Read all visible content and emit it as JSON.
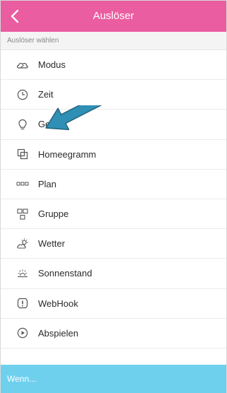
{
  "header": {
    "title": "Auslöser",
    "back_icon": "chevron-left-icon",
    "background_color": "#ea5da0"
  },
  "section": {
    "label": "Auslöser wählen"
  },
  "items": [
    {
      "label": "Modus",
      "icon": "cloud-icon"
    },
    {
      "label": "Zeit",
      "icon": "clock-icon"
    },
    {
      "label": "Gerät",
      "icon": "lightbulb-icon"
    },
    {
      "label": "Homeegramm",
      "icon": "homeegramm-icon"
    },
    {
      "label": "Plan",
      "icon": "plan-icon"
    },
    {
      "label": "Gruppe",
      "icon": "group-icon"
    },
    {
      "label": "Wetter",
      "icon": "weather-icon"
    },
    {
      "label": "Sonnenstand",
      "icon": "sun-icon"
    },
    {
      "label": "WebHook",
      "icon": "webhook-icon"
    },
    {
      "label": "Abspielen",
      "icon": "play-icon"
    }
  ],
  "annotation": {
    "icon": "arrow-icon",
    "color": "#2f8fb4",
    "target": "Gerät"
  },
  "footer": {
    "label": "Wenn...",
    "background_color": "#6fd0ee"
  }
}
